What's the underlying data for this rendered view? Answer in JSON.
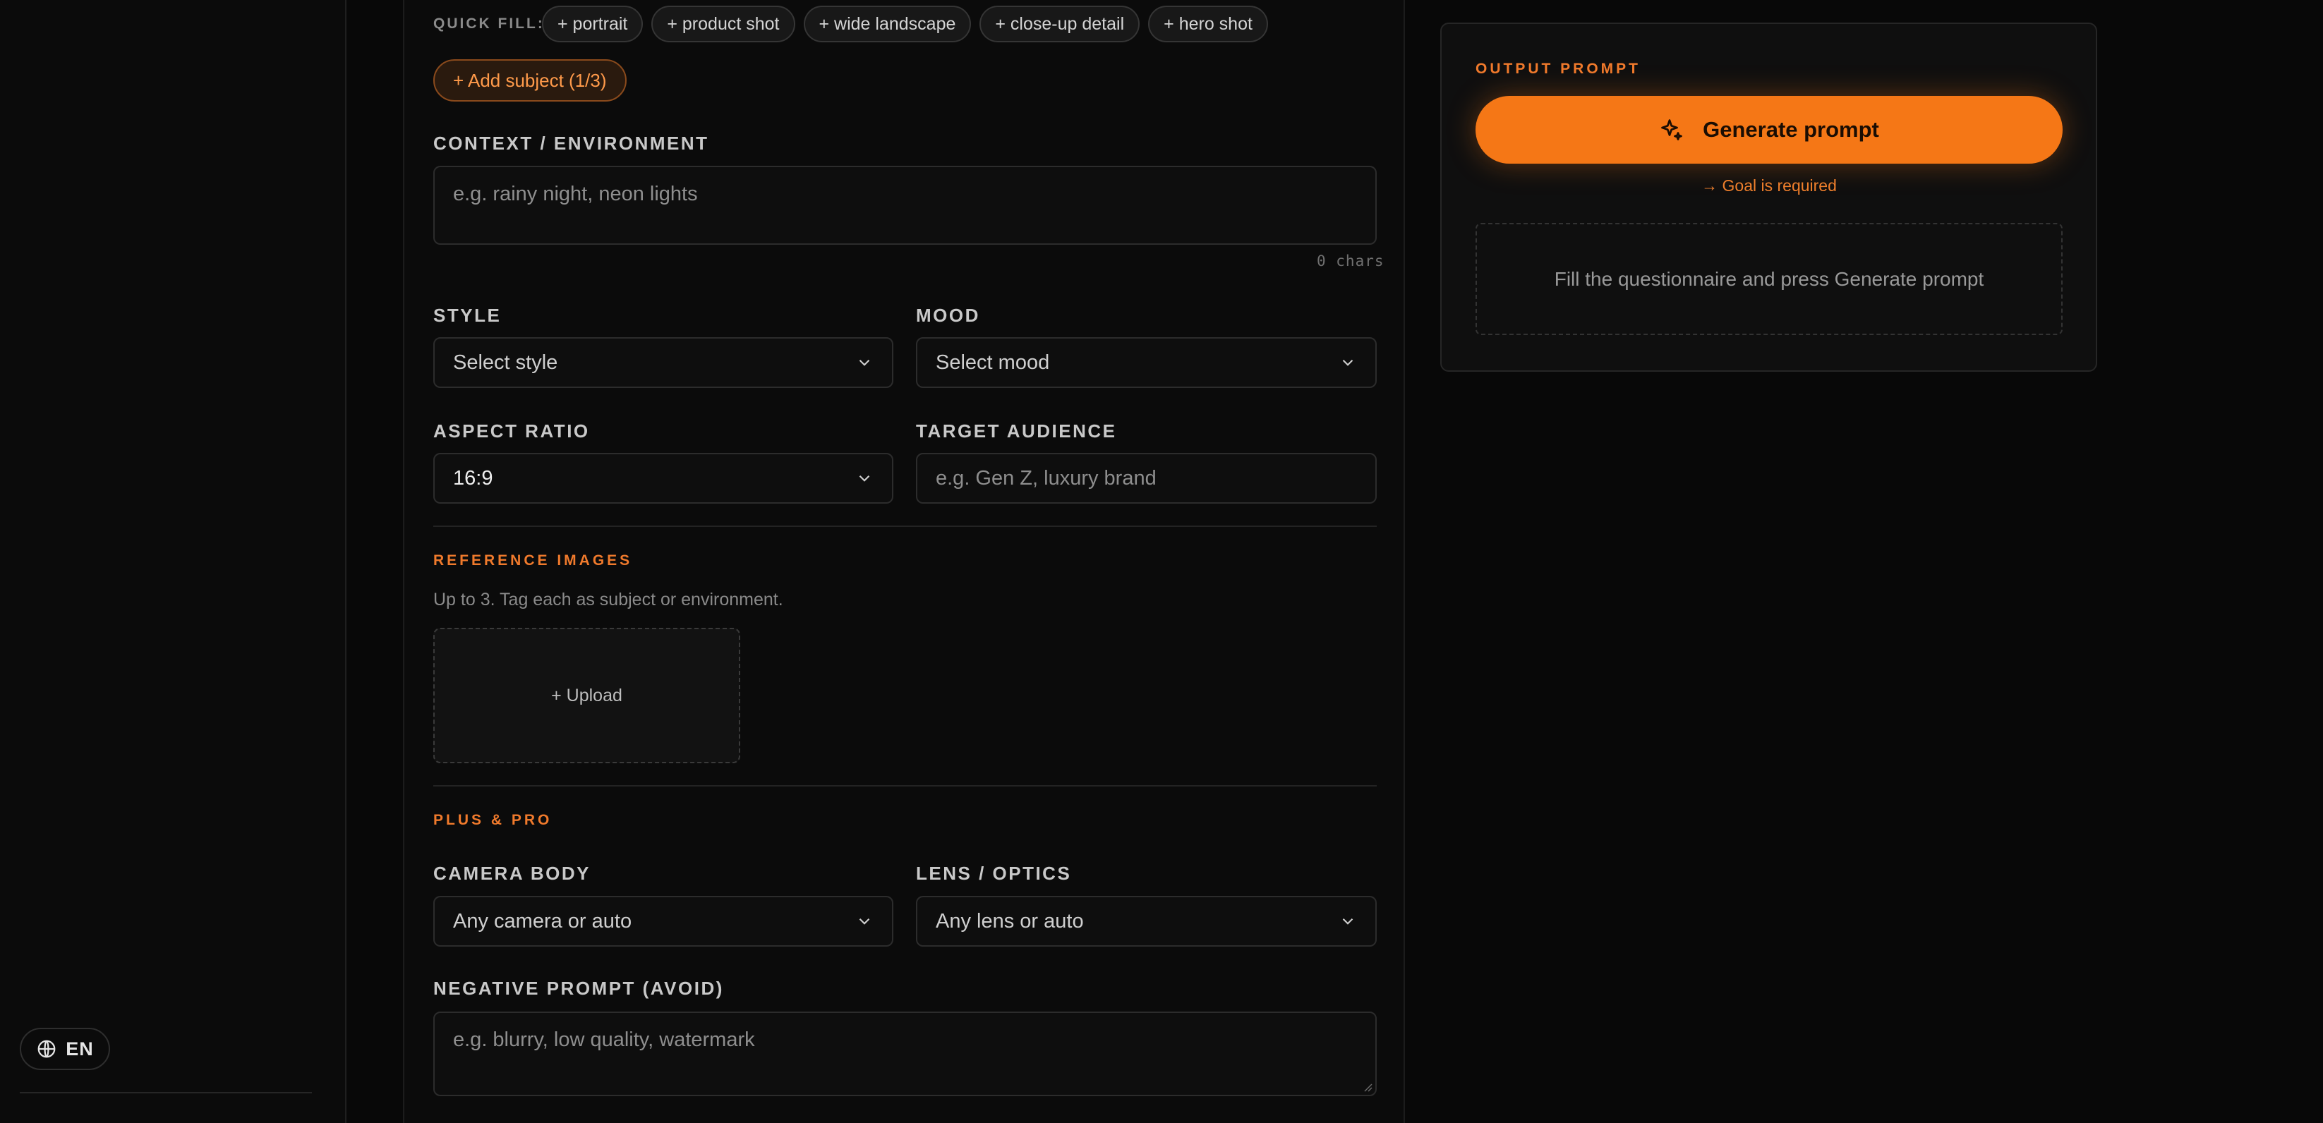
{
  "sidebar": {
    "language": {
      "label": "EN",
      "icon": "globe-icon"
    }
  },
  "form": {
    "quick_fill": {
      "label": "QUICK FILL:",
      "chips": [
        "+ portrait",
        "+ product shot",
        "+ wide landscape",
        "+ close-up detail",
        "+ hero shot"
      ]
    },
    "add_subject": "+ Add subject (1/3)",
    "context": {
      "label": "CONTEXT / ENVIRONMENT",
      "placeholder": "e.g. rainy night, neon lights",
      "counter": "0 chars"
    },
    "style": {
      "label": "STYLE",
      "value": "Select style"
    },
    "mood": {
      "label": "MOOD",
      "value": "Select mood"
    },
    "aspect_ratio": {
      "label": "ASPECT RATIO",
      "value": "16:9"
    },
    "target_audience": {
      "label": "TARGET AUDIENCE",
      "placeholder": "e.g. Gen Z, luxury brand"
    },
    "reference_images": {
      "section_label": "REFERENCE IMAGES",
      "hint": "Up to 3. Tag each as subject or environment.",
      "upload_label": "+ Upload"
    },
    "plus_pro": {
      "section_label": "PLUS & PRO",
      "camera": {
        "label": "CAMERA BODY",
        "value": "Any camera or auto"
      },
      "lens": {
        "label": "LENS / OPTICS",
        "value": "Any lens or auto"
      }
    },
    "negative_prompt": {
      "label": "NEGATIVE PROMPT (AVOID)",
      "placeholder": "e.g. blurry, low quality, watermark"
    }
  },
  "output": {
    "section_label": "OUTPUT PROMPT",
    "generate_label": "Generate prompt",
    "generate_icon": "sparkle-icon",
    "validation": "→ Goal is required",
    "empty_state": "Fill the questionnaire and press Generate prompt"
  },
  "colors": {
    "accent": "#f57716",
    "background": "#080808",
    "panel": "#0b0b0b"
  }
}
